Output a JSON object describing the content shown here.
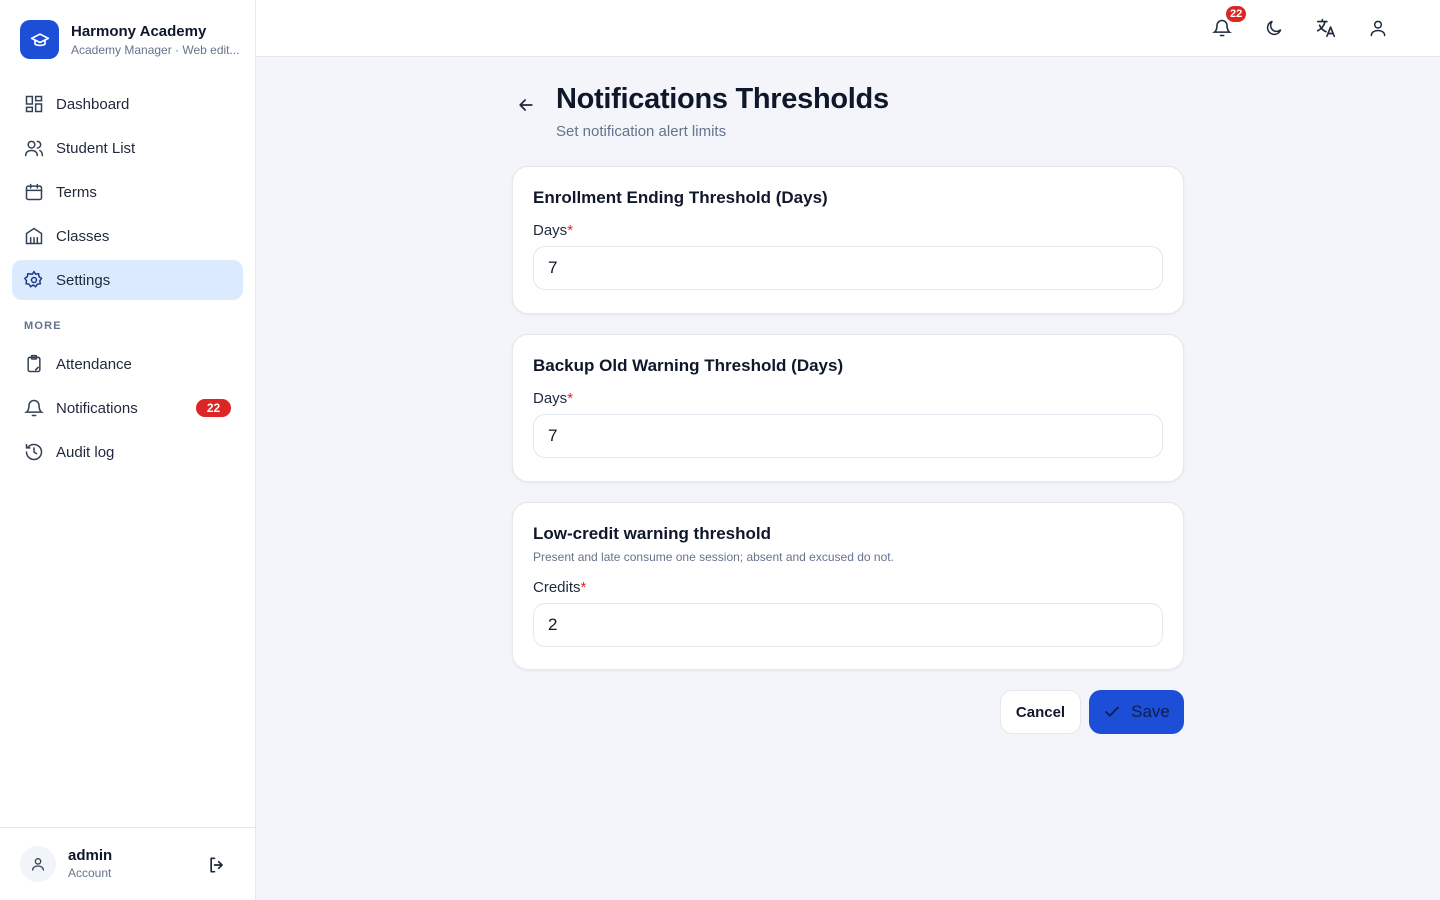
{
  "brand": {
    "title": "Harmony Academy",
    "subtitle": "Academy Manager · Web edit..."
  },
  "sidebar": {
    "items": [
      {
        "label": "Dashboard",
        "icon": "dashboard-icon"
      },
      {
        "label": "Student List",
        "icon": "users-icon"
      },
      {
        "label": "Terms",
        "icon": "calendar-icon"
      },
      {
        "label": "Classes",
        "icon": "building-icon"
      },
      {
        "label": "Settings",
        "icon": "gear-icon",
        "active": true
      }
    ],
    "section_more": "MORE",
    "more_items": [
      {
        "label": "Attendance",
        "icon": "clipboard-icon"
      },
      {
        "label": "Notifications",
        "icon": "bell-icon",
        "badge": "22"
      },
      {
        "label": "Audit log",
        "icon": "history-icon"
      }
    ]
  },
  "user": {
    "name": "admin",
    "role": "Account"
  },
  "topbar": {
    "notification_count": "22"
  },
  "page": {
    "title": "Notifications Thresholds",
    "subtitle": "Set notification alert limits"
  },
  "cards": [
    {
      "title": "Enrollment Ending Threshold (Days)",
      "field_label": "Days",
      "required_mark": "*",
      "value": "7"
    },
    {
      "title": "Backup Old Warning Threshold (Days)",
      "field_label": "Days",
      "required_mark": "*",
      "value": "7"
    },
    {
      "title": "Low-credit warning threshold",
      "description": "Present and late consume one session; absent and excused do not.",
      "field_label": "Credits",
      "required_mark": "*",
      "value": "2"
    }
  ],
  "actions": {
    "cancel_label": "Cancel",
    "save_label": "Save"
  },
  "colors": {
    "accent": "#1d4ed8",
    "active_nav_bg": "#dbeafe",
    "badge": "#dc2626",
    "page_bg": "#f3f5fa"
  }
}
